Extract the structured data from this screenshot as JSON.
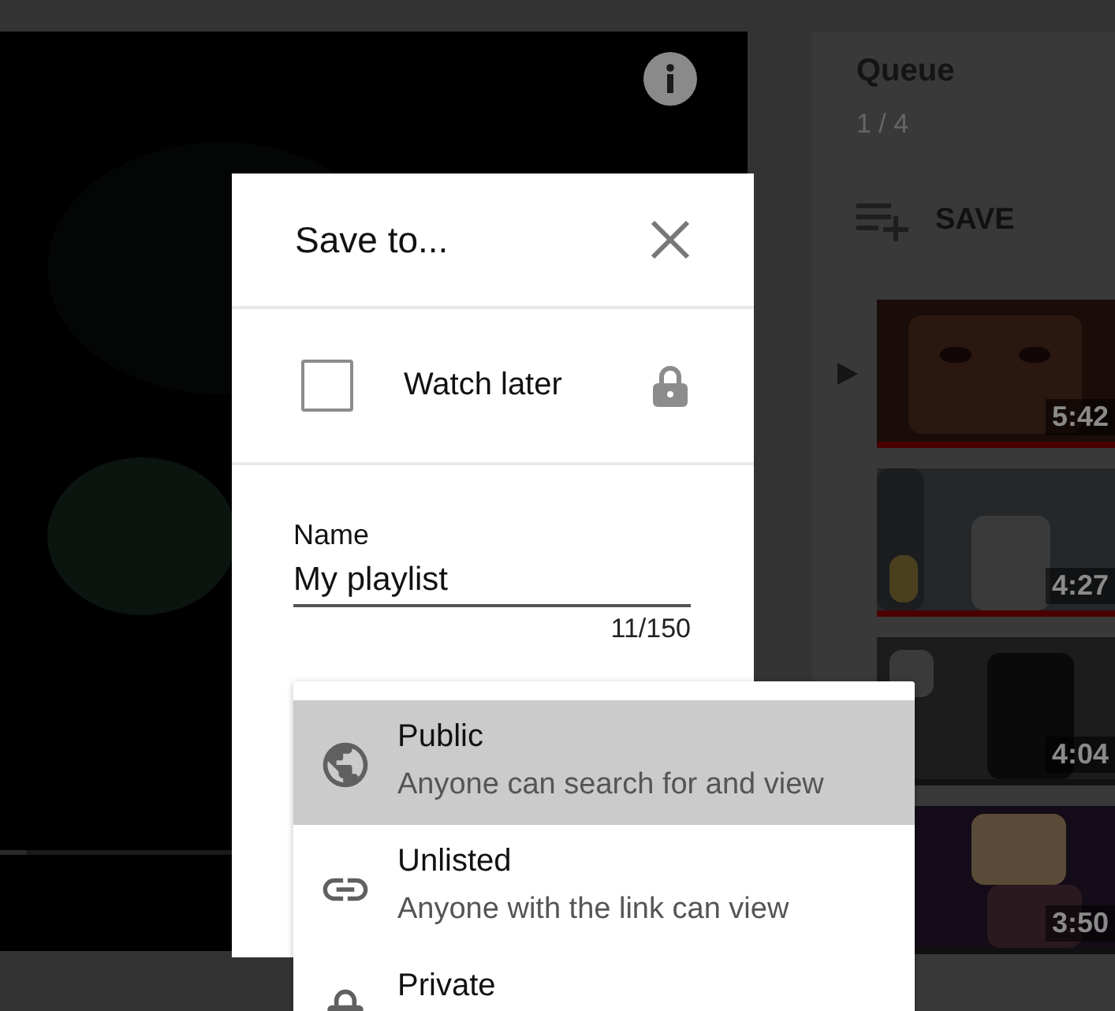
{
  "queue": {
    "title": "Queue",
    "position": "1 / 4",
    "save_label": "SAVE",
    "items": [
      {
        "duration": "5:42",
        "playing": true,
        "watched": true
      },
      {
        "duration": "4:27",
        "playing": false,
        "watched": true
      },
      {
        "duration": "4:04",
        "playing": false,
        "watched": false
      },
      {
        "duration": "3:50",
        "playing": false,
        "watched": false
      }
    ]
  },
  "dialog": {
    "title": "Save to...",
    "playlists": [
      {
        "label": "Watch later",
        "checked": false,
        "locked": true
      }
    ],
    "name_field": {
      "label": "Name",
      "value": "My playlist",
      "counter": "11/150"
    },
    "privacy_menu": [
      {
        "kind": "public",
        "label": "Public",
        "description": "Anyone can search for and view",
        "selected": true
      },
      {
        "kind": "unlisted",
        "label": "Unlisted",
        "description": "Anyone with the link can view",
        "selected": false
      },
      {
        "kind": "private",
        "label": "Private",
        "selected": false
      }
    ]
  }
}
